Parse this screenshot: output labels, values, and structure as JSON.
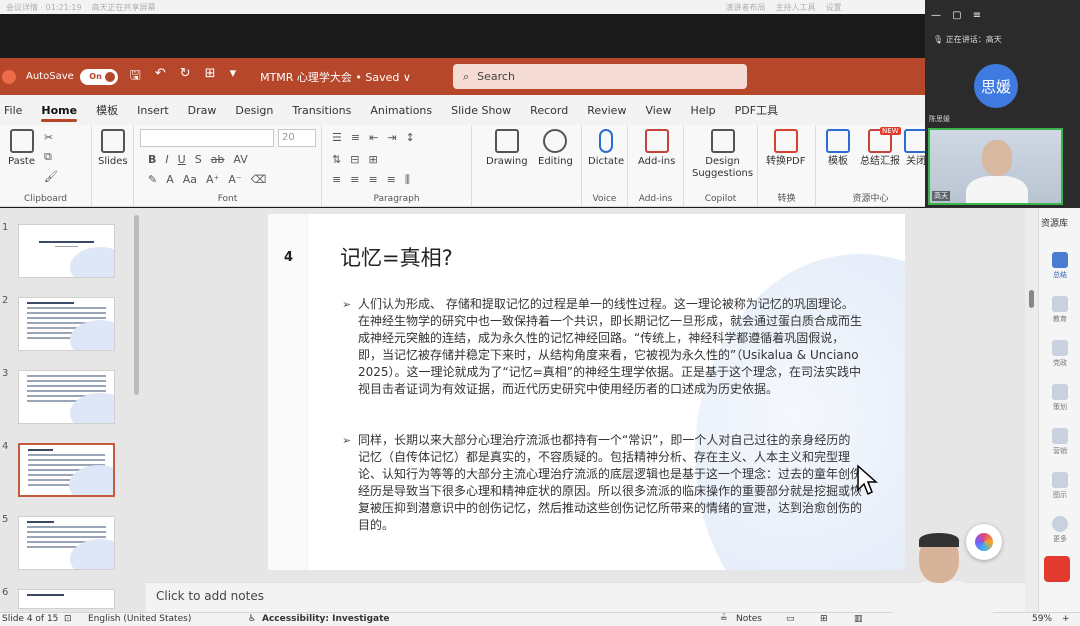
{
  "meeting_strip": {
    "items": [
      "会议详情 · 01:21:19",
      "高天正在共享屏幕",
      "演讲者布局",
      "主持人工具",
      "设置"
    ]
  },
  "titlebar": {
    "autosave_label": "AutoSave",
    "autosave_state": "On",
    "doc_title": "MTMR 心理学大会 • Saved ∨",
    "search_placeholder": "Search"
  },
  "menu_tabs": [
    "File",
    "Home",
    "模板",
    "Insert",
    "Draw",
    "Design",
    "Transitions",
    "Animations",
    "Slide Show",
    "Record",
    "Review",
    "View",
    "Help",
    "PDF工具"
  ],
  "ribbon": {
    "groups": {
      "clipboard": "Clipboard",
      "font": "Font",
      "paragraph": "Paragraph",
      "voice": "Voice",
      "addins": "Add-ins",
      "copilot": "Copilot",
      "convert": "转换",
      "resource_center": "资源中心"
    },
    "buttons": {
      "paste": "Paste",
      "slides": "Slides",
      "drawing": "Drawing",
      "editing": "Editing",
      "dictate": "Dictate",
      "addins": "Add-ins",
      "design_suggestions": "Design\nSuggestions",
      "to_pdf": "转换PDF",
      "templates": "模板",
      "summary_report": "总结汇报",
      "more": "关闭"
    },
    "font_size": "20",
    "font_row": [
      "B",
      "I",
      "U",
      "S",
      "ab",
      "AV"
    ],
    "badge_new": "NEW"
  },
  "thumbnails": [
    {
      "num": "1"
    },
    {
      "num": "2"
    },
    {
      "num": "3"
    },
    {
      "num": "4",
      "selected": true
    },
    {
      "num": "5"
    },
    {
      "num": "6"
    }
  ],
  "slide": {
    "number": "4",
    "title": "记忆=真相?",
    "para1": "人们认为形成、 存储和提取记忆的过程是单一的线性过程。这一理论被称为记忆的巩固理论。在神经生物学的研究中也一致保持着一个共识，即长期记忆一旦形成，就会通过蛋白质合成而生成神经元突触的连结，成为永久性的记忆神经回路。“传统上，神经科学都遵循着巩固假说，即，当记忆被存储并稳定下来时，从结构角度来看，它被视为永久性的”（Usikalua & Unciano 2025）。这一理论就成为了“记忆=真相”的神经生理学依据。正是基于这个理念，在司法实践中视目击者证词为有效证据，而近代历史研究中使用经历者的口述成为历史依据。",
    "para2": "同样，长期以来大部分心理治疗流派也都持有一个“常识”，即一个人对自己过往的亲身经历的记忆（自传体记忆）都是真实的，不容质疑的。包括精神分析、存在主义、人本主义和完型理论、认知行为等等的大部分主流心理治疗流派的底层逻辑也是基于这一个理念：过去的童年创伤经历是导致当下很多心理和精神症状的原因。所以很多流派的临床操作的重要部分就是挖掘或恢复被压抑到潜意识中的创伤记忆，然后推动这些创伤记忆所带来的情绪的宣泄，达到治愈创伤的目的。"
  },
  "notes_placeholder": "Click to add notes",
  "statusbar": {
    "slide_count": "Slide 4 of 15",
    "language": "English (United States)",
    "accessibility": "Accessibility: Investigate",
    "notes": "Notes",
    "zoom": "59%"
  },
  "resource_panel": {
    "title": "资源库",
    "items": [
      "总结",
      "教育",
      "党政",
      "策划",
      "营销",
      "图示",
      "更多"
    ]
  },
  "meeting": {
    "controls": "— ▢ ≡",
    "speaking_label": "正在讲话：",
    "speaking_name": "高天",
    "avatar_text": "思媛",
    "participant1": "陈思媛",
    "video_name": "高天"
  },
  "colors": {
    "ppt_red": "#b7472a",
    "avatar_blue": "#3e7ae0",
    "active_speaker": "#3bb54a"
  }
}
